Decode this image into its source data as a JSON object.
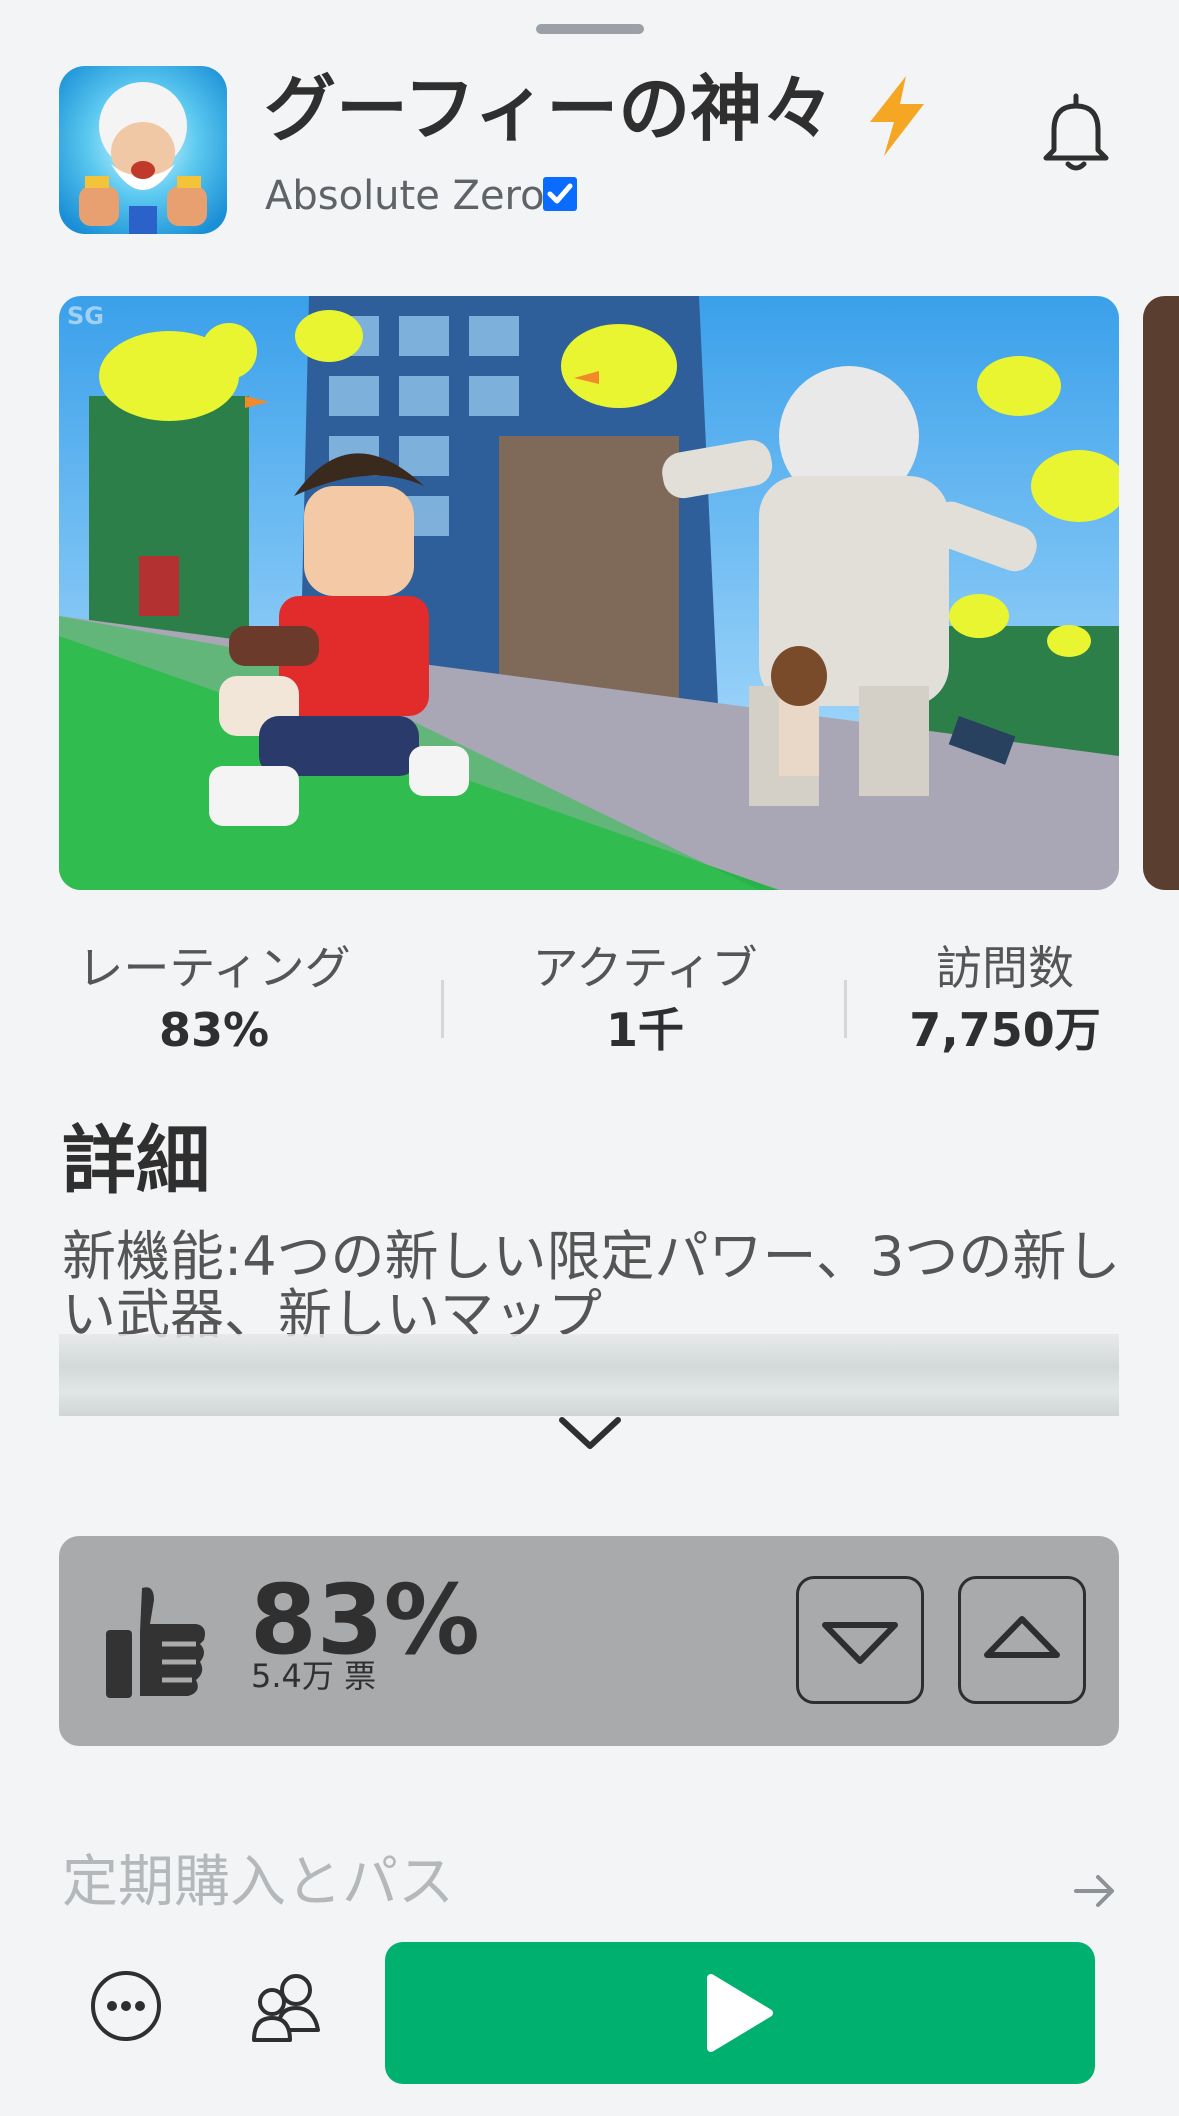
{
  "header": {
    "title": "グーフィーの神々",
    "creator": "Absolute Zero!",
    "icons": {
      "app": "app-icon-zeus",
      "bolt": "lightning-icon",
      "verified": "verified-check-icon",
      "bell": "bell-icon"
    }
  },
  "stats": [
    {
      "label": "レーティング",
      "value": "83%"
    },
    {
      "label": "アクティブ",
      "value": "1千"
    },
    {
      "label": "訪問数",
      "value": "7,750万"
    }
  ],
  "details": {
    "title": "詳細",
    "description": "新機能:4つの新しい限定パワー、3つの新しい武器、新しいマップ"
  },
  "votes": {
    "percent": "83%",
    "count": "5.4万 票"
  },
  "subscriptions": {
    "label": "定期購入とパス"
  },
  "colors": {
    "accent_green": "#00b06f",
    "verified_blue": "#0a6cff",
    "bolt_orange": "#f5a623"
  }
}
